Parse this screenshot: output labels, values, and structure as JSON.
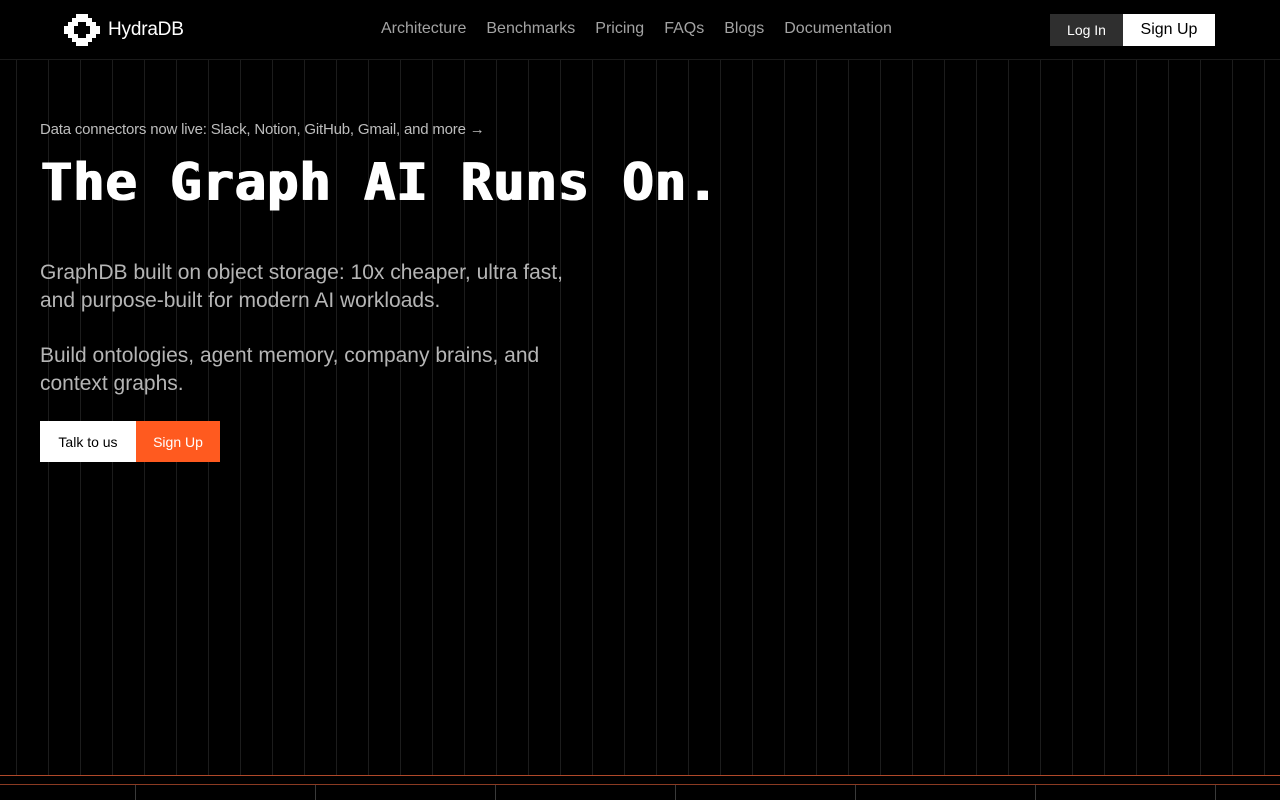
{
  "brand": {
    "name": "HydraDB",
    "logo_icon": "hydra-logo-icon"
  },
  "nav": {
    "items": [
      {
        "label": "Architecture"
      },
      {
        "label": "Benchmarks"
      },
      {
        "label": "Pricing"
      },
      {
        "label": "FAQs"
      },
      {
        "label": "Blogs"
      },
      {
        "label": "Documentation"
      }
    ]
  },
  "auth": {
    "login_label": "Log In",
    "signup_label": "Sign Up"
  },
  "hero": {
    "announcement": "Data connectors now live: Slack, Notion, GitHub, Gmail, and more →",
    "title": "The Graph AI Runs On.",
    "subtitle_1": "GraphDB built on object storage: 10x cheaper, ultra fast, and purpose-built for modern AI workloads.",
    "subtitle_2": "Build ontologies, agent memory, company brains, and context graphs.",
    "cta_talk": "Talk to us",
    "cta_signup": "Sign Up"
  },
  "colors": {
    "background": "#000000",
    "accent": "#ff5a1f",
    "nav_text": "#a3a3a3",
    "login_bg": "#2f2f2f"
  }
}
